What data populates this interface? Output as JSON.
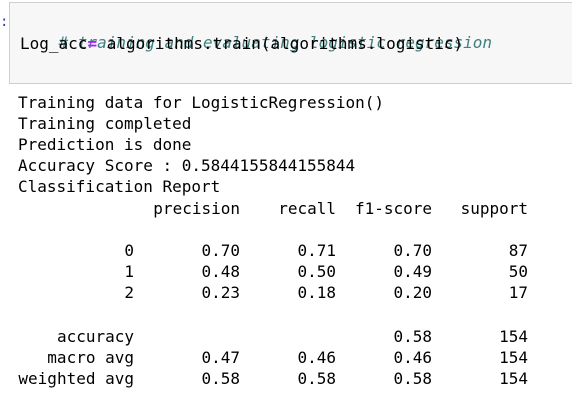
{
  "code_cell": {
    "prompt": ":",
    "comment": "# training and evaluating logistic regression",
    "line2_var": "Log_acc",
    "line2_op": "=",
    "line2_rest": " algorithms.train(algorithms.logistic)"
  },
  "output": {
    "lines": [
      "Training data for LogisticRegression()",
      "Training completed",
      "Prediction is done",
      "Accuracy Score : 0.5844155844155844",
      "Classification Report"
    ],
    "report": {
      "headers": [
        "precision",
        "recall",
        "f1-score",
        "support"
      ],
      "class_rows": [
        {
          "label": "0",
          "precision": "0.70",
          "recall": "0.71",
          "f1": "0.70",
          "support": "87"
        },
        {
          "label": "1",
          "precision": "0.48",
          "recall": "0.50",
          "f1": "0.49",
          "support": "50"
        },
        {
          "label": "2",
          "precision": "0.23",
          "recall": "0.18",
          "f1": "0.20",
          "support": "17"
        }
      ],
      "summary_rows": [
        {
          "label": "accuracy",
          "precision": "",
          "recall": "",
          "f1": "0.58",
          "support": "154"
        },
        {
          "label": "macro avg",
          "precision": "0.47",
          "recall": "0.46",
          "f1": "0.46",
          "support": "154"
        },
        {
          "label": "weighted avg",
          "precision": "0.58",
          "recall": "0.58",
          "f1": "0.58",
          "support": "154"
        }
      ]
    }
  }
}
